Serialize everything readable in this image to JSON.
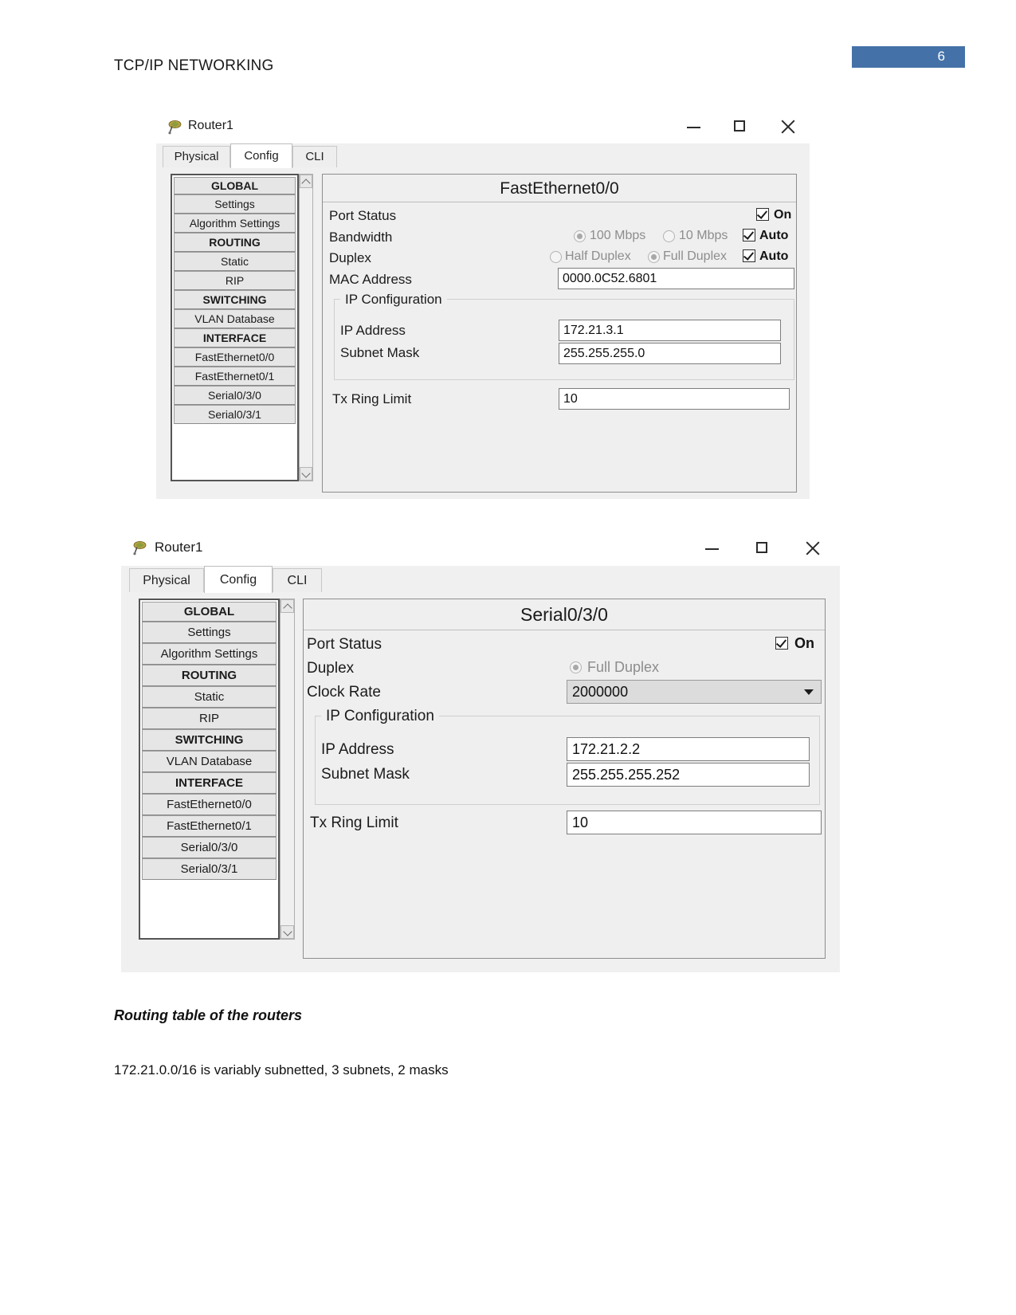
{
  "document": {
    "header_title": "TCP/IP NETWORKING",
    "page_number": "6",
    "page_badge_color": "#4472a8",
    "heading": "Routing table of the routers",
    "paragraph": "172.21.0.0/16 is variably subnetted, 3 subnets, 2 masks"
  },
  "sidebar": {
    "items": [
      {
        "label": "GLOBAL",
        "type": "header"
      },
      {
        "label": "Settings",
        "type": "item"
      },
      {
        "label": "Algorithm Settings",
        "type": "item"
      },
      {
        "label": "ROUTING",
        "type": "header"
      },
      {
        "label": "Static",
        "type": "item"
      },
      {
        "label": "RIP",
        "type": "item"
      },
      {
        "label": "SWITCHING",
        "type": "header"
      },
      {
        "label": "VLAN Database",
        "type": "item"
      },
      {
        "label": "INTERFACE",
        "type": "header"
      },
      {
        "label": "FastEthernet0/0",
        "type": "item"
      },
      {
        "label": "FastEthernet0/1",
        "type": "item"
      },
      {
        "label": "Serial0/3/0",
        "type": "item"
      },
      {
        "label": "Serial0/3/1",
        "type": "item"
      }
    ]
  },
  "window1": {
    "title": "Router1",
    "title_icon": "router-icon",
    "controls": {
      "minimize": "minimize-icon",
      "maximize": "maximize-icon",
      "close": "close-icon"
    },
    "tabs": [
      {
        "label": "Physical",
        "active": false
      },
      {
        "label": "Config",
        "active": true
      },
      {
        "label": "CLI",
        "active": false
      }
    ],
    "panel": {
      "title": "FastEthernet0/0",
      "port_status_label": "Port Status",
      "port_status_on_label": "On",
      "port_status_checked": true,
      "bandwidth_label": "Bandwidth",
      "bandwidth_options": [
        {
          "label": "100 Mbps",
          "selected": true
        },
        {
          "label": "10 Mbps",
          "selected": false
        }
      ],
      "bandwidth_auto_label": "Auto",
      "bandwidth_auto_checked": true,
      "duplex_label": "Duplex",
      "duplex_options": [
        {
          "label": "Half Duplex",
          "selected": false
        },
        {
          "label": "Full Duplex",
          "selected": true
        }
      ],
      "duplex_auto_label": "Auto",
      "duplex_auto_checked": true,
      "mac_label": "MAC Address",
      "mac_value": "0000.0C52.6801",
      "ip_group_legend": "IP Configuration",
      "ip_address_label": "IP Address",
      "ip_address_value": "172.21.3.1",
      "subnet_mask_label": "Subnet Mask",
      "subnet_mask_value": "255.255.255.0",
      "tx_ring_label": "Tx Ring Limit",
      "tx_ring_value": "10"
    }
  },
  "window2": {
    "title": "Router1",
    "title_icon": "router-icon",
    "controls": {
      "minimize": "minimize-icon",
      "maximize": "maximize-icon",
      "close": "close-icon"
    },
    "tabs": [
      {
        "label": "Physical",
        "active": false
      },
      {
        "label": "Config",
        "active": true
      },
      {
        "label": "CLI",
        "active": false
      }
    ],
    "panel": {
      "title": "Serial0/3/0",
      "port_status_label": "Port Status",
      "port_status_on_label": "On",
      "port_status_checked": true,
      "duplex_label": "Duplex",
      "duplex_options": [
        {
          "label": "Full Duplex",
          "selected": true
        }
      ],
      "clock_rate_label": "Clock Rate",
      "clock_rate_value": "2000000",
      "ip_group_legend": "IP Configuration",
      "ip_address_label": "IP Address",
      "ip_address_value": "172.21.2.2",
      "subnet_mask_label": "Subnet Mask",
      "subnet_mask_value": "255.255.255.252",
      "tx_ring_label": "Tx Ring Limit",
      "tx_ring_value": "10"
    }
  }
}
